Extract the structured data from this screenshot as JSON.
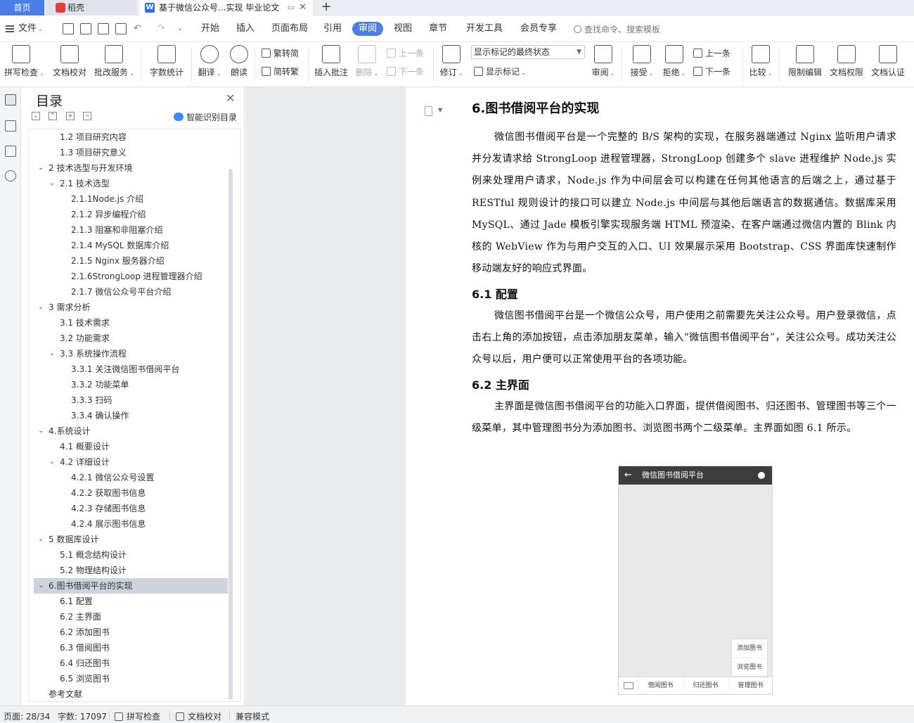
{
  "tabs": {
    "home": "首页",
    "daoke": "稻壳",
    "doc": "基于微信公众号...实现 毕业论文",
    "add": "+"
  },
  "menu": {
    "file": "文件",
    "items": [
      "开始",
      "插入",
      "页面布局",
      "引用",
      "审阅",
      "视图",
      "章节",
      "开发工具",
      "会员专享"
    ],
    "active": "审阅",
    "search_placeholder": "查找命令、搜索模板"
  },
  "ribbon": {
    "spell_check": "拼写检查",
    "doc_proof": "文档校对",
    "batch_service": "批改服务",
    "word_count": "字数统计",
    "translate": "翻译",
    "read_aloud": "朗读",
    "trad_to_simp": "繁转简",
    "simp_to_trad": "简转繁",
    "insert_comment": "插入批注",
    "delete": "删除",
    "prev_item": "上一条",
    "next_item": "下一条",
    "revise": "修订",
    "markup_select": "显示标记的最终状态",
    "show_markup": "显示标记",
    "review": "审阅",
    "accept": "接受",
    "reject": "拒绝",
    "prev_change": "上一条",
    "next_change": "下一条",
    "compare": "比较",
    "restrict_edit": "限制编辑",
    "doc_permission": "文档权限",
    "doc_certify": "文档认证"
  },
  "toc": {
    "title": "目录",
    "smart": "智能识别目录",
    "items": [
      {
        "label": "1.2 项目研究内容",
        "level": 2
      },
      {
        "label": "1.3 项目研究意义",
        "level": 2
      },
      {
        "label": "2 技术选型与开发环境",
        "level": 1,
        "arrow": "⌄"
      },
      {
        "label": "2.1 技术选型",
        "level": 2,
        "arrow": "⌄"
      },
      {
        "label": "2.1.1Node.js 介绍",
        "level": 3
      },
      {
        "label": "2.1.2 异步编程介绍",
        "level": 3
      },
      {
        "label": "2.1.3 阻塞和非阻塞介绍",
        "level": 3
      },
      {
        "label": "2.1.4 MySQL 数据库介绍",
        "level": 3
      },
      {
        "label": "2.1.5 Nginx 服务器介绍",
        "level": 3
      },
      {
        "label": "2.1.6StrongLoop 进程管理器介绍",
        "level": 3
      },
      {
        "label": "2.1.7 微信公众号平台介绍",
        "level": 3
      },
      {
        "label": "3 需求分析",
        "level": 1,
        "arrow": "⌄"
      },
      {
        "label": "3.1 技术需求",
        "level": 2
      },
      {
        "label": "3.2 功能需求",
        "level": 2
      },
      {
        "label": "3.3 系统操作流程",
        "level": 2,
        "arrow": "⌄"
      },
      {
        "label": "3.3.1 关注微信图书借阅平台",
        "level": 3
      },
      {
        "label": "3.3.2 功能菜单",
        "level": 3
      },
      {
        "label": "3.3.3 扫码",
        "level": 3
      },
      {
        "label": "3.3.4 确认操作",
        "level": 3
      },
      {
        "label": "4.系统设计",
        "level": 1,
        "arrow": "⌄"
      },
      {
        "label": "4.1 概要设计",
        "level": 2
      },
      {
        "label": "4.2 详细设计",
        "level": 2,
        "arrow": "⌄"
      },
      {
        "label": "4.2.1 微信公众号设置",
        "level": 3
      },
      {
        "label": "4.2.2 获取图书信息",
        "level": 3
      },
      {
        "label": "4.2.3 存储图书信息",
        "level": 3
      },
      {
        "label": "4.2.4 展示图书信息",
        "level": 3
      },
      {
        "label": "5 数据库设计",
        "level": 1,
        "arrow": "⌄"
      },
      {
        "label": "5.1 概念结构设计",
        "level": 2
      },
      {
        "label": "5.2 物理结构设计",
        "level": 2
      },
      {
        "label": "6.图书借阅平台的实现",
        "level": 1,
        "arrow": "⌄",
        "active": true
      },
      {
        "label": "6.1 配置",
        "level": 2
      },
      {
        "label": "6.2 主界面",
        "level": 2
      },
      {
        "label": "6.2 添加图书",
        "level": 2
      },
      {
        "label": "6.3 借阅图书",
        "level": 2
      },
      {
        "label": "6.4 归还图书",
        "level": 2
      },
      {
        "label": "6.5 浏览图书",
        "level": 2
      },
      {
        "label": "参考文献",
        "level": 1
      }
    ]
  },
  "document": {
    "heading": "6.图书借阅平台的实现",
    "para1": "微信图书借阅平台是一个完整的 B/S 架构的实现，在服务器端通过 Nginx 监听用户请求并分发请求给 StrongLoop 进程管理器，StrongLoop 创建多个 slave 进程维护 Node.js 实例来处理用户请求，Node.js 作为中间层会可以构建在任何其他语言的后端之上，通过基于 RESTful 规则设计的接口可以建立 Node.js 中间层与其他后端语言的数据通信。数据库采用 MySQL、通过 Jade 模板引擎实现服务端 HTML 预渲染、在客户端通过微信内置的 Blink 内核的 WebView 作为与用户交互的入口、UI 效果展示采用 Bootstrap、CSS 界面库快速制作移动端友好的响应式界面。",
    "h2_1": "6.1 配置",
    "para2": "微信图书借阅平台是一个微信公众号，用户使用之前需要先关注公众号。用户登录微信，点击右上角的添加按钮，点击添加朋友菜单，输入“微信图书借阅平台”，关注公众号。成功关注公众号以后，用户便可以正常使用平台的各项功能。",
    "h2_2": "6.2 主界面",
    "para3": "主界面是微信图书借阅平台的功能入口界面，提供借阅图书、归还图书、管理图书等三个一级菜单，其中管理图书分为添加图书、浏览图书两个二级菜单。主界面如图 6.1 所示。",
    "phone": {
      "back": "←",
      "title": "微信图书借阅平台",
      "popup": [
        "添加图书",
        "浏览图书"
      ],
      "tabs": [
        "借阅图书",
        "归还图书",
        "管理图书"
      ]
    }
  },
  "status": {
    "page": "页面: 28/34",
    "words": "字数: 17097",
    "spell": "拼写检查",
    "proof": "文档校对",
    "compat": "兼容模式"
  }
}
